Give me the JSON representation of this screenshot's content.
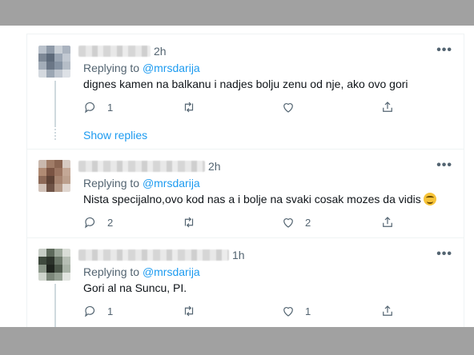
{
  "tweets": [
    {
      "time": "2h",
      "replying_prefix": "Replying to ",
      "replying_handle": "@mrsdarija",
      "text": "dignes kamen na balkanu i nadjes bolju zenu od nje, ako ovo gori",
      "replies": "1",
      "retweets": "",
      "likes": "",
      "show_replies": "Show replies"
    },
    {
      "time": "2h",
      "replying_prefix": "Replying to ",
      "replying_handle": "@mrsdarija",
      "text": "Nista specijalno,ovo kod nas a i bolje na svaki cosak mozes da vidis",
      "emoji": "smiling-face-emoji",
      "replies": "2",
      "retweets": "",
      "likes": "2"
    },
    {
      "time": "1h",
      "replying_prefix": "Replying to ",
      "replying_handle": "@mrsdarija",
      "text": "Gori al na Suncu, PI.",
      "replies": "1",
      "retweets": "",
      "likes": "1"
    }
  ],
  "icons": {
    "more": "more-icon",
    "reply": "reply-icon",
    "retweet": "retweet-icon",
    "like": "heart-icon",
    "share": "share-icon"
  },
  "colors": {
    "link": "#1d9bf0",
    "secondary_text": "#536471",
    "overlay_bar": "#a1a1a1"
  }
}
